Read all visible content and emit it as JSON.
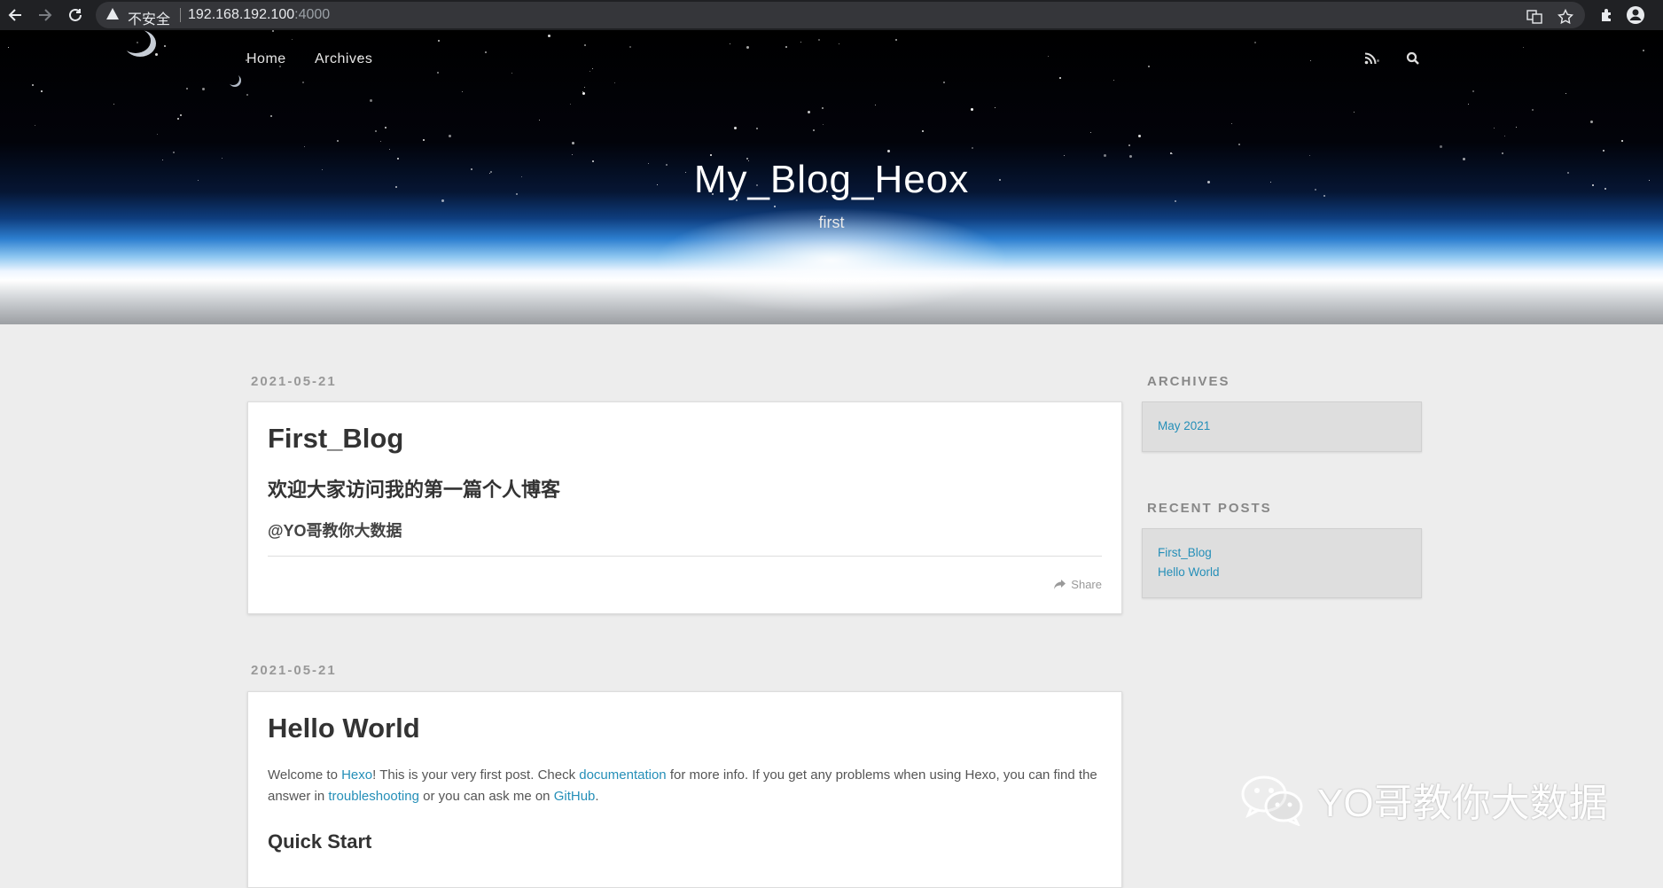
{
  "browser": {
    "security_label": "不安全",
    "url_host": "192.168.192.100",
    "url_port": ":4000"
  },
  "nav": {
    "items": [
      "Home",
      "Archives"
    ]
  },
  "site": {
    "title": "My_Blog_Heox",
    "subtitle": "first"
  },
  "posts": [
    {
      "date": "2021-05-21",
      "title": "First_Blog",
      "heading": "欢迎大家访问我的第一篇个人博客",
      "subheading": "@YO哥教你大数据",
      "share_label": "Share"
    },
    {
      "date": "2021-05-21",
      "title": "Hello World",
      "para": {
        "t1": "Welcome to ",
        "l1": "Hexo",
        "t2": "! This is your very first post. Check ",
        "l2": "documentation",
        "t3": " for more info. If you get any problems when using Hexo, you can find the answer in ",
        "l3": "troubleshooting",
        "t4": " or you can ask me on ",
        "l4": "GitHub",
        "t5": "."
      },
      "section_heading": "Quick Start"
    }
  ],
  "sidebar": {
    "archives_title": "ARCHIVES",
    "archives": [
      "May 2021"
    ],
    "recent_title": "RECENT POSTS",
    "recent": [
      "First_Blog",
      "Hello World"
    ]
  },
  "watermark": {
    "text": "YO哥教你大数据",
    "icon": "wechat-icon"
  },
  "colors": {
    "link": "#258fb8",
    "page_bg": "#ededed"
  }
}
